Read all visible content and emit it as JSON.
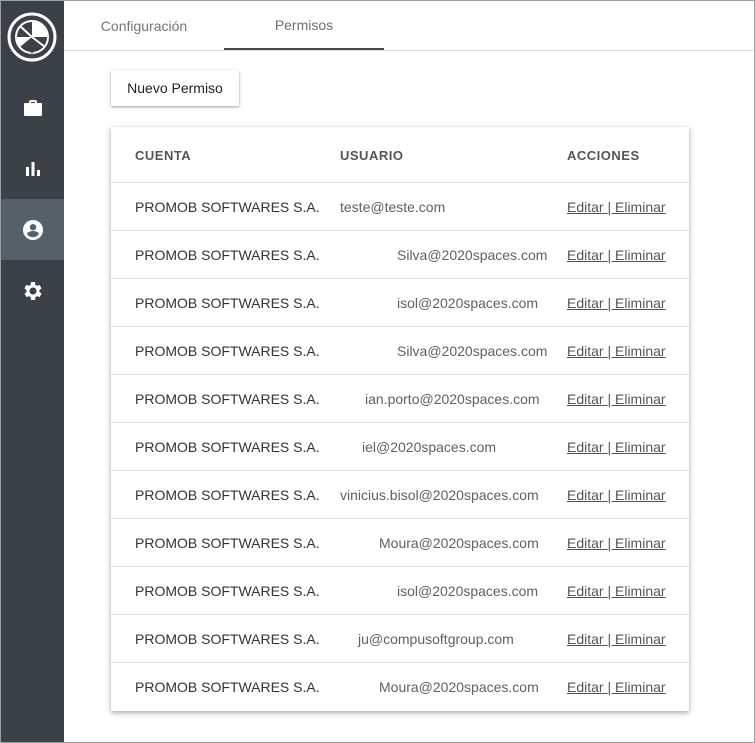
{
  "sidebar": {
    "items": [
      {
        "icon": "briefcase-icon"
      },
      {
        "icon": "bar-chart-icon"
      },
      {
        "icon": "account-circle-icon",
        "active": true
      },
      {
        "icon": "gear-icon"
      }
    ]
  },
  "tabs": [
    {
      "label": "Configuración"
    },
    {
      "label": "Permisos",
      "active": true
    }
  ],
  "toolbar": {
    "new_label": "Nuevo Permiso"
  },
  "table": {
    "headers": {
      "account": "CUENTA",
      "user": "USUARIO",
      "actions": "ACCIONES"
    },
    "rows": [
      {
        "account": "PROMOB SOFTWARES S.A.",
        "user": "teste@teste.com",
        "edit": "Editar",
        "sep": " | ",
        "delete": "Eliminar"
      },
      {
        "account": "PROMOB SOFTWARES S.A.",
        "user": "Silva@2020spaces.com",
        "edit": "Editar",
        "sep": " | ",
        "delete": "Eliminar"
      },
      {
        "account": "PROMOB SOFTWARES S.A.",
        "user": "isol@2020spaces.com",
        "edit": "Editar",
        "sep": " | ",
        "delete": "Eliminar"
      },
      {
        "account": "PROMOB SOFTWARES S.A.",
        "user": "Silva@2020spaces.com",
        "edit": "Editar",
        "sep": " | ",
        "delete": "Eliminar"
      },
      {
        "account": "PROMOB SOFTWARES S.A.",
        "user": "ian.porto@2020spaces.com",
        "edit": "Editar",
        "sep": " | ",
        "delete": "Eliminar"
      },
      {
        "account": "PROMOB SOFTWARES S.A.",
        "user": "iel@2020spaces.com",
        "edit": "Editar",
        "sep": " | ",
        "delete": "Eliminar"
      },
      {
        "account": "PROMOB SOFTWARES S.A.",
        "user": "vinicius.bisol@2020spaces.com",
        "edit": "Editar",
        "sep": " | ",
        "delete": "Eliminar"
      },
      {
        "account": "PROMOB SOFTWARES S.A.",
        "user": "Moura@2020spaces.com",
        "edit": "Editar",
        "sep": " | ",
        "delete": "Eliminar"
      },
      {
        "account": "PROMOB SOFTWARES S.A.",
        "user": "isol@2020spaces.com",
        "edit": "Editar",
        "sep": " | ",
        "delete": "Eliminar"
      },
      {
        "account": "PROMOB SOFTWARES S.A.",
        "user": "ju@compusoftgroup.com",
        "edit": "Editar",
        "sep": " | ",
        "delete": "Eliminar"
      },
      {
        "account": "PROMOB SOFTWARES S.A.",
        "user": "Moura@2020spaces.com",
        "edit": "Editar",
        "sep": " | ",
        "delete": "Eliminar"
      }
    ]
  },
  "colors": {
    "sidebar": "#3a4148",
    "sidebar_active": "#56606a",
    "tab_indicator": "#424b53"
  }
}
